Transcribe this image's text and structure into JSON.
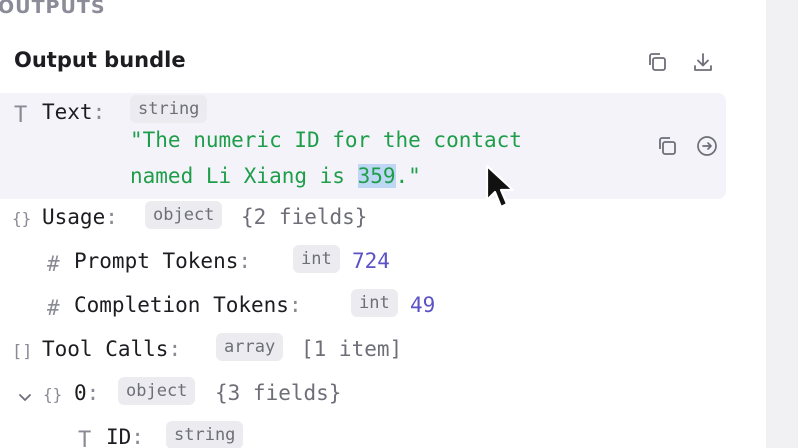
{
  "section": {
    "title": "OUTPUTS"
  },
  "bundle": {
    "title": "Output bundle"
  },
  "rows": {
    "text": {
      "key": "Text",
      "type": "string",
      "line1": "\"The numeric ID for the contact",
      "line2_pre": "named Li Xiang is ",
      "line2_sel": "359",
      "line2_post": ".\""
    },
    "usage": {
      "key": "Usage",
      "type": "object",
      "summary": "{2 fields}"
    },
    "prompt_tokens": {
      "key": "Prompt Tokens",
      "type": "int",
      "value": "724"
    },
    "completion_tokens": {
      "key": "Completion Tokens",
      "type": "int",
      "value": "49"
    },
    "tool_calls": {
      "key": "Tool Calls",
      "type": "array",
      "summary": "[1 item]"
    },
    "item0": {
      "key": "0",
      "type": "object",
      "summary": "{3 fields}"
    },
    "id": {
      "key": "ID",
      "type": "string"
    }
  },
  "colon": ":",
  "type_icons": {
    "text": "T",
    "object": "{}",
    "number": "#",
    "array": "[]"
  },
  "icons": [
    "copy-icon",
    "download-icon",
    "arrow-right-circle-icon",
    "chevron-down-icon",
    "mouse-cursor-icon"
  ],
  "colors": {
    "string": "#1f9e4a",
    "number": "#5a52c6",
    "selection": "#bdd7f4",
    "row_highlight": "#f3f3f9"
  }
}
